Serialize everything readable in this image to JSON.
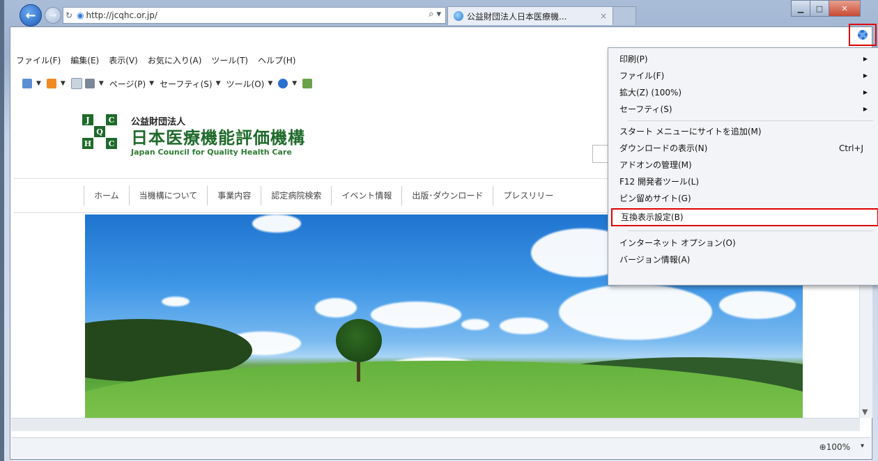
{
  "browser": {
    "address_url": "http://jcqhc.or.jp/",
    "tab_title": "公益財団法人日本医療機...",
    "menu_bar": [
      "ファイル(F)",
      "編集(E)",
      "表示(V)",
      "お気に入り(A)",
      "ツール(T)",
      "ヘルプ(H)"
    ],
    "command_bar": {
      "page": "ページ(P)",
      "safety": "セーフティ(S)",
      "tools": "ツール(O)"
    },
    "zoom": "100%"
  },
  "site": {
    "logo_sub": "公益財団法人",
    "logo_main": "日本医療機能評価機構",
    "logo_en": "Japan Council for Quality Health Care",
    "logo_letters": [
      "J",
      "C",
      "Q",
      "H",
      "C"
    ],
    "nav": [
      "ホーム",
      "当機構について",
      "事業内容",
      "認定病院検索",
      "イベント情報",
      "出版･ダウンロード",
      "プレスリリー"
    ]
  },
  "tools_menu": {
    "items": [
      {
        "label": "印刷(P)",
        "submenu": true
      },
      {
        "label": "ファイル(F)",
        "submenu": true
      },
      {
        "label": "拡大(Z) (100%)",
        "submenu": true
      },
      {
        "label": "セーフティ(S)",
        "submenu": true
      },
      {
        "label": "スタート メニューにサイトを追加(M)"
      },
      {
        "label": "ダウンロードの表示(N)",
        "shortcut": "Ctrl+J"
      },
      {
        "label": "アドオンの管理(M)"
      },
      {
        "label": "F12 開発者ツール(L)"
      },
      {
        "label": "ピン留めサイト(G)"
      },
      {
        "label": "互換表示設定(B)",
        "highlighted": true
      },
      {
        "label": "インターネット オプション(O)"
      },
      {
        "label": "バージョン情報(A)"
      }
    ]
  },
  "colors": {
    "highlight_border": "#e00000",
    "logo_green": "#1e6a2a"
  }
}
